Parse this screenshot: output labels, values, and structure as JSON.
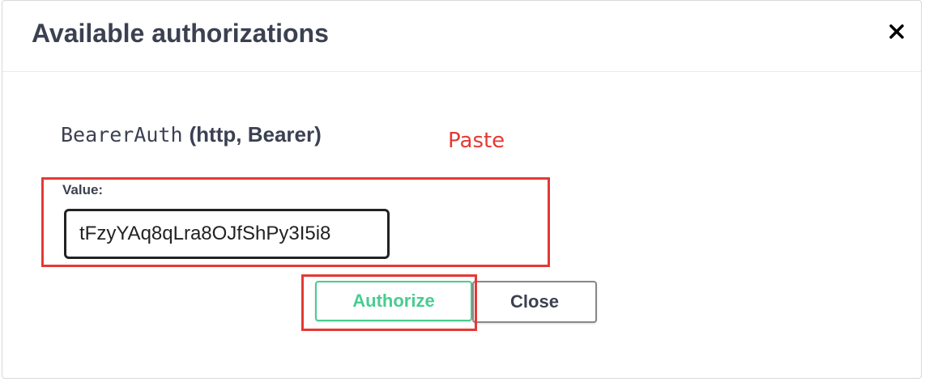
{
  "modal": {
    "title": "Available authorizations"
  },
  "auth": {
    "scheme_name": "BearerAuth",
    "scheme_type": "(http, Bearer)",
    "value_label": "Value:",
    "value_input": "tFzyYAq8qLra8OJfShPy3I5i8"
  },
  "buttons": {
    "authorize_label": "Authorize",
    "close_label": "Close"
  },
  "annotation": {
    "paste_label": "Paste",
    "color": "#e53935"
  },
  "colors": {
    "title_text": "#3b4151",
    "authorize_green": "#49cc90"
  },
  "icons": {
    "close": "close-icon"
  }
}
